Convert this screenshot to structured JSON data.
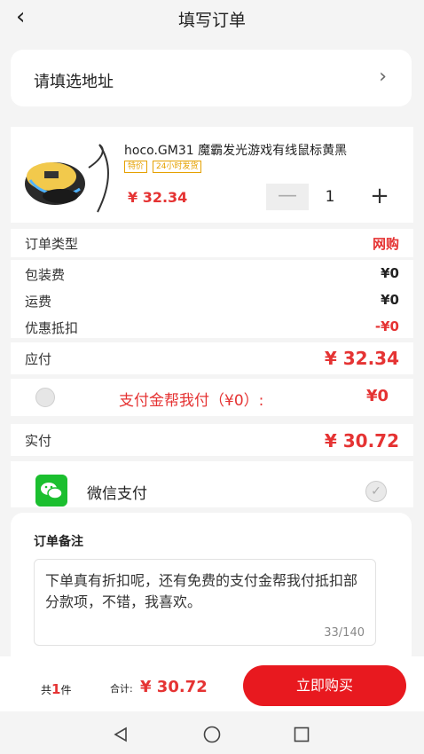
{
  "header": {
    "title": "填写订单"
  },
  "address": {
    "label": "请填选地址"
  },
  "product": {
    "name": "hoco.GM31 魔霸发光游戏有线鼠标黄黑",
    "tags": [
      "特价",
      "24小时发货"
    ],
    "price": "¥ 32.34",
    "quantity": "1"
  },
  "order": {
    "type_label": "订单类型",
    "type_value": "网购",
    "packing_label": "包装费",
    "packing_value": "¥0",
    "shipping_label": "运费",
    "shipping_value": "¥0",
    "discount_label": "优惠抵扣",
    "discount_value": "-¥0",
    "payable_label": "应付",
    "payable_value": "¥ 32.34",
    "help_pay_label": "支付金帮我付（¥0）:",
    "help_pay_value": "¥0",
    "actual_label": "实付",
    "actual_value": "¥ 30.72"
  },
  "payment": {
    "method": "微信支付"
  },
  "notes": {
    "title": "订单备注",
    "text": "下单真有折扣呢，还有免费的支付金帮我付抵扣部分款项，不错，我喜欢。",
    "count": "33/140"
  },
  "footer": {
    "count_prefix": "共",
    "count_num": "1",
    "count_suffix": "件",
    "total_label": "合计:",
    "total": "¥ 30.72",
    "buy_label": "立即购买"
  },
  "colors": {
    "accent": "#e53333",
    "button": "#e8191f",
    "wechat": "#1bbf2f"
  }
}
